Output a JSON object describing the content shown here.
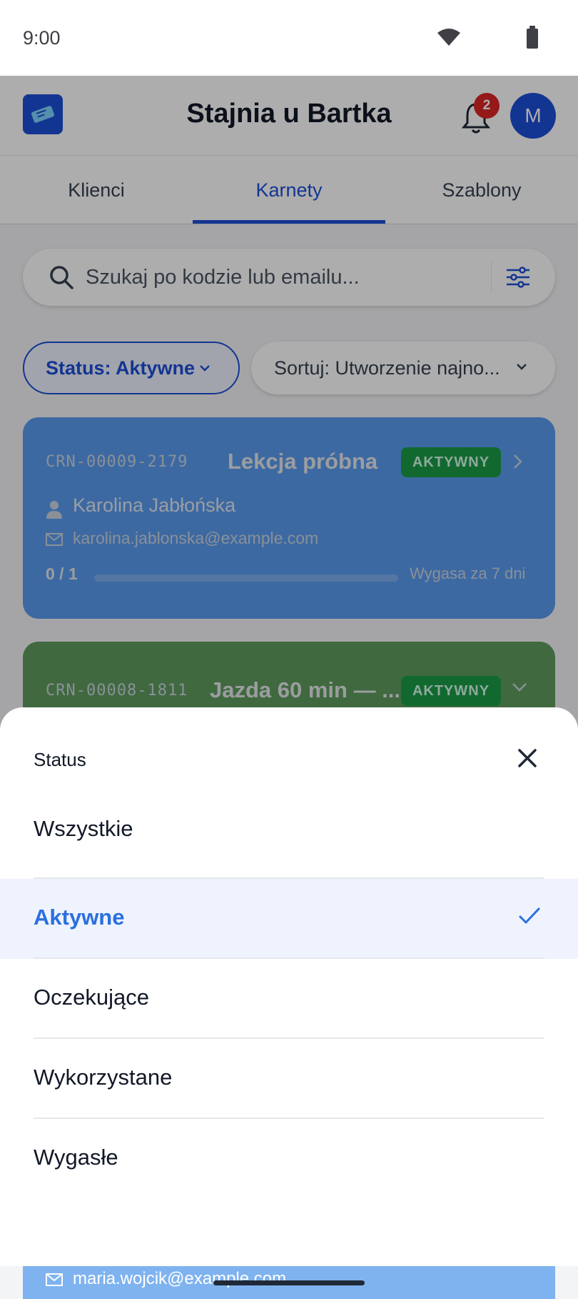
{
  "status_bar": {
    "time": "9:00"
  },
  "header": {
    "title": "Stajnia u Bartka",
    "notification_count": "2",
    "avatar_initial": "M"
  },
  "tabs": [
    {
      "label": "Klienci"
    },
    {
      "label": "Karnety",
      "active": true
    },
    {
      "label": "Szablony"
    }
  ],
  "search": {
    "placeholder": "Szukaj po kodzie lub emailu..."
  },
  "filters": {
    "status_label": "Status: Aktywne",
    "sort_label": "Sortuj: Utworzenie najno..."
  },
  "cards": [
    {
      "code": "CRN-00009-2179",
      "title": "Lekcja próbna",
      "badge": "AKTYWNY",
      "person": "Karolina Jabłońska",
      "email": "karolina.jablonska@example.com",
      "progress": "0 / 1",
      "progress_fraction": 0,
      "expiry": "Wygasa za 7 dni",
      "color": "#5b9bef"
    },
    {
      "code": "CRN-00008-1811",
      "title": "Jazda 60 min — ...",
      "badge": "AKTYWNY",
      "color": "#5f9b5d"
    }
  ],
  "bottom_card": {
    "email": "maria.wojcik@example.com"
  },
  "status_sheet": {
    "title": "Status",
    "options": [
      {
        "label": "Wszystkie",
        "selected": false
      },
      {
        "label": "Aktywne",
        "selected": true
      },
      {
        "label": "Oczekujące",
        "selected": false
      },
      {
        "label": "Wykorzystane",
        "selected": false
      },
      {
        "label": "Wygasłe",
        "selected": false
      }
    ]
  },
  "colors": {
    "accent": "#1d4ed8",
    "selected_option": "#2b6fe0",
    "badge_active": "#1a9b47",
    "notification": "#dc2626"
  },
  "icons": [
    "wifi-icon",
    "battery-icon",
    "ticket-icon",
    "bell-icon",
    "search-icon",
    "filter-icon",
    "chevron-down-icon",
    "chevron-right-icon",
    "person-icon",
    "mail-icon",
    "close-icon",
    "check-icon"
  ]
}
